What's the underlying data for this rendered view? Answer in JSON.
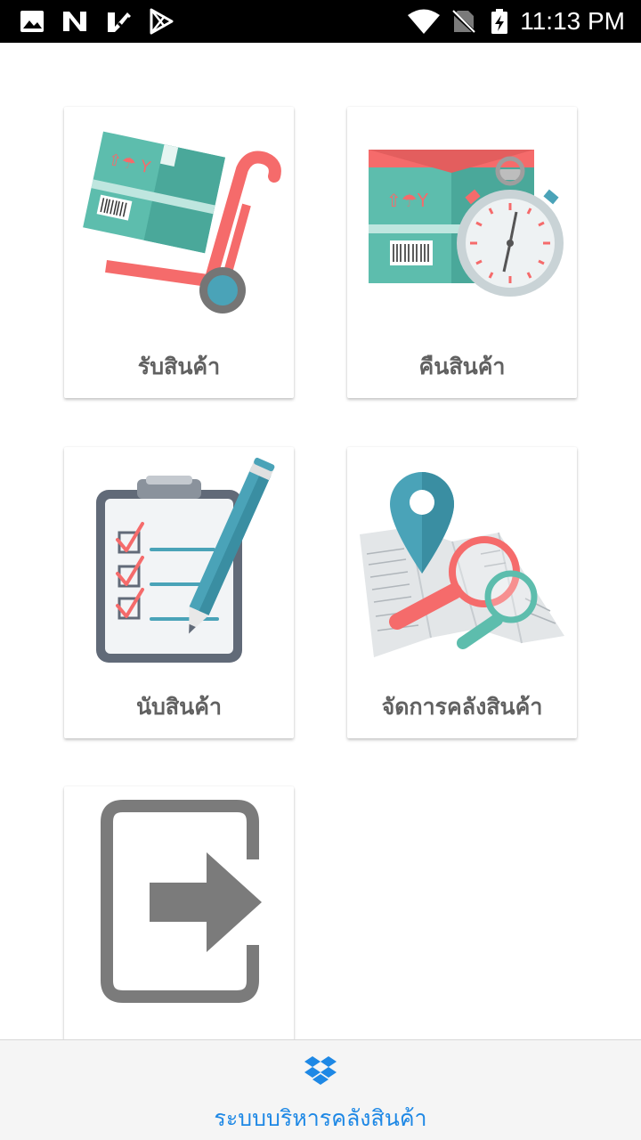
{
  "status_bar": {
    "time": "11:13 PM",
    "left_icons": [
      "image-icon",
      "n-notification-icon",
      "check-notification-icon",
      "play-store-icon"
    ],
    "right_icons": [
      "wifi-icon",
      "no-sim-icon",
      "battery-charging-icon"
    ]
  },
  "menu": {
    "receive_label": "รับสินค้า",
    "return_label": "คืนสินค้า",
    "count_label": "นับสินค้า",
    "manage_label": "จัดการคลังสินค้า",
    "logout_label": "ออกจากระบบ"
  },
  "bottom_bar": {
    "icon": "dropbox-box-icon",
    "label": "ระบบบริหารคลังสินค้า",
    "color": "#1e88e5"
  },
  "colors": {
    "teal": "#5dbdad",
    "coral": "#f56b6b",
    "gray": "#7b7b7b",
    "blue": "#4aa3b8"
  }
}
